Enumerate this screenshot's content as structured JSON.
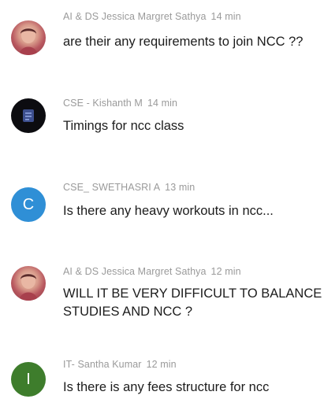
{
  "messages": [
    {
      "sender": "AI & DS Jessica Margret Sathya",
      "time": "14 min",
      "text": "are their any requirements to join NCC ??",
      "avatar": {
        "kind": "photo",
        "icon": "profile-photo"
      }
    },
    {
      "sender": "CSE - Kishanth M",
      "time": "14 min",
      "text": "Timings for ncc class",
      "avatar": {
        "kind": "photo",
        "icon": "profile-photo",
        "color": "#0c0c10"
      }
    },
    {
      "sender": "CSE_ SWETHASRI A",
      "time": "13 min",
      "text": "Is there any heavy workouts in ncc...",
      "avatar": {
        "kind": "letter",
        "letter": "C",
        "color": "#2f8fd6"
      }
    },
    {
      "sender": "AI & DS Jessica Margret Sathya",
      "time": "12 min",
      "text": "WILL IT BE VERY DIFFICULT TO BALANCE STUDIES AND NCC ?",
      "avatar": {
        "kind": "photo",
        "icon": "profile-photo"
      }
    },
    {
      "sender": "IT- Santha Kumar",
      "time": "12 min",
      "text": "Is there is any fees structure for ncc",
      "avatar": {
        "kind": "letter",
        "letter": "I",
        "color": "#3e7d2c"
      }
    }
  ]
}
